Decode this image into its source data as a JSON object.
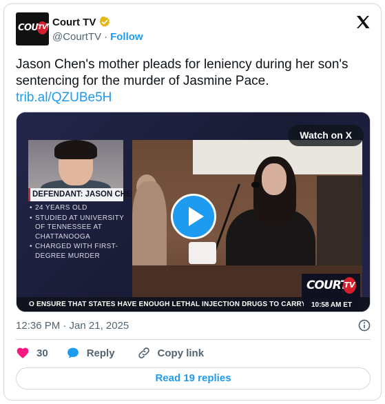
{
  "account": {
    "display_name": "Court TV",
    "handle": "@CourtTV",
    "separator": "·",
    "follow_label": "Follow",
    "avatar_logo_text": "COURT",
    "avatar_logo_tv": "TV"
  },
  "tweet": {
    "text": "Jason Chen's mother pleads for leniency during her son's sentencing for the murder of Jasmine Pace.",
    "link": "trib.al/QZUBe5H"
  },
  "media": {
    "watch_label": "Watch on X",
    "defendant_label": "DEFENDANT: JASON CHEN",
    "facts": [
      "24 YEARS OLD",
      "STUDIED AT UNIVERSITY OF TENNESSEE AT CHATTANOOGA",
      "CHARGED WITH FIRST-DEGREE MURDER"
    ],
    "ticker_text": "O ENSURE THAT STATES HAVE ENOUGH LETHAL INJECTION DRUGS TO CARRY OUT EXECUTI",
    "ticker_time": "10:58 AM ET",
    "logo_text": "COURT",
    "logo_tv": "TV"
  },
  "meta": {
    "timestamp": "12:36 PM · Jan 21, 2025"
  },
  "actions": {
    "like_count": "30",
    "reply_label": "Reply",
    "copy_label": "Copy link"
  },
  "footer": {
    "read_replies_label": "Read 19 replies"
  },
  "colors": {
    "accent": "#1d9bf0",
    "like": "#f91880",
    "verified": "#e2b719",
    "text_secondary": "#536471"
  }
}
